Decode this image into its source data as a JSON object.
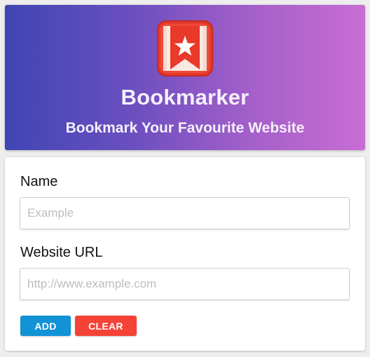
{
  "header": {
    "title": "Bookmarker",
    "subtitle": "Bookmark Your Favourite Website",
    "logo_icon": "bookmark-star-icon",
    "gradient_colors": [
      "#3f46b4",
      "#c86dd3"
    ]
  },
  "form": {
    "name_label": "Name",
    "name_value": "",
    "name_placeholder": "Example",
    "url_label": "Website URL",
    "url_value": "",
    "url_placeholder": "http://www.example.com",
    "add_label": "ADD",
    "clear_label": "CLEAR",
    "add_color": "#1193d6",
    "clear_color": "#f44336"
  }
}
